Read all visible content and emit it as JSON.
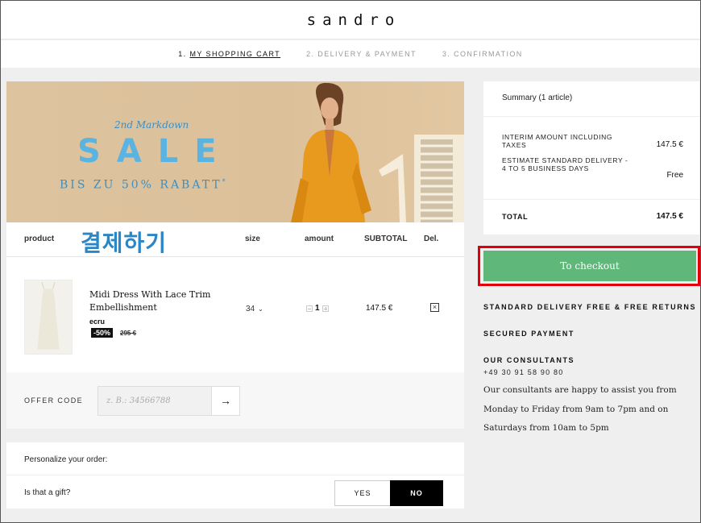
{
  "header": {
    "logo": "sandro"
  },
  "steps": [
    {
      "number": "1.",
      "label": "MY SHOPPING CART"
    },
    {
      "label": "2. DELIVERY & PAYMENT"
    },
    {
      "label": "3. CONFIRMATION"
    }
  ],
  "banner": {
    "subtitle": "2nd Markdown",
    "headline": "SALE",
    "tagline": "BIS ZU 50% RABATT",
    "tagline_mark": "*"
  },
  "cart": {
    "headers": {
      "product": "product",
      "size": "size",
      "amount": "amount",
      "subtotal": "SUBTOTAL",
      "del": "Del."
    },
    "overlay_text": "결제하기",
    "item": {
      "name": "Midi Dress With Lace Trim Embellishment",
      "color": "ecru",
      "discount": "-50%",
      "old_price": "295 €",
      "size": "34",
      "quantity": "1",
      "subtotal": "147.5 €",
      "delete_glyph": "×"
    }
  },
  "offer": {
    "label": "OFFER CODE",
    "placeholder": "z. B.: 34566788",
    "submit_glyph": "→"
  },
  "personalize": {
    "label": "Personalize your order:",
    "gift_label": "Is that a gift?",
    "yes": "YES",
    "no": "NO"
  },
  "summary": {
    "title": "Summary (1 article)",
    "interim_label": "INTERIM AMOUNT INCLUDING TAXES",
    "interim_value": "147.5 €",
    "delivery_label": "ESTIMATE STANDARD DELIVERY - 4 TO 5 BUSINESS DAYS",
    "delivery_value": "Free",
    "total_label": "TOTAL",
    "total_value": "147.5 €"
  },
  "checkout": {
    "label": "To checkout",
    "color": "#5fb87a",
    "highlight": "#e0000c"
  },
  "info": {
    "delivery": "STANDARD DELIVERY FREE & FREE RETURNS",
    "secured": "SECURED PAYMENT",
    "consultants": "OUR CONSULTANTS",
    "phone": "+49 30 91 58 90 80",
    "hours": "Our consultants are happy to assist you from Monday to Friday from 9am to 7pm and on Saturdays from 10am to 5pm"
  }
}
